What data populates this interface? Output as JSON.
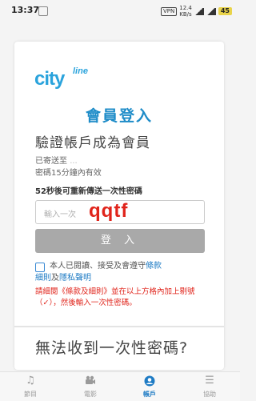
{
  "status_bar": {
    "time": "13:37",
    "vpn": "VPN",
    "network_speed": "12.4\nKB/s",
    "battery": "45"
  },
  "logo": {
    "main": "city",
    "sub": "line"
  },
  "page_title": "會員登入",
  "heading": "驗證帳戶成為會員",
  "info": {
    "sent_prefix": "已寄送至",
    "sent_masked": "...",
    "validity": "密碼15分鐘內有效"
  },
  "resend_text": "52秒後可重新傳送一次性密碼",
  "otp": {
    "placeholder": "輸入一次",
    "value": "qqtf"
  },
  "login_button": "登 入",
  "agree": {
    "prefix": "本人已閱讀、接受及會遵守",
    "link1": "條款",
    "link1_cont": "細則",
    "and": "及",
    "link2": "隱私聲明"
  },
  "warning": "請細閱《條款及細則》並在以上方格內加上剔號（✓），然後輸入一次性密碼。",
  "cant_receive": "無法收到一次性密碼?",
  "nav": [
    {
      "label": "節目",
      "icon": "music-note-icon",
      "active": false
    },
    {
      "label": "電影",
      "icon": "movie-camera-icon",
      "active": false
    },
    {
      "label": "帳戶",
      "icon": "account-icon",
      "active": true
    },
    {
      "label": "協助",
      "icon": "menu-list-icon",
      "active": false
    }
  ],
  "colors": {
    "brand": "#2aa3dc",
    "link": "#1e7bc4",
    "warning": "#e0241b",
    "button_disabled": "#a9a9a9"
  }
}
